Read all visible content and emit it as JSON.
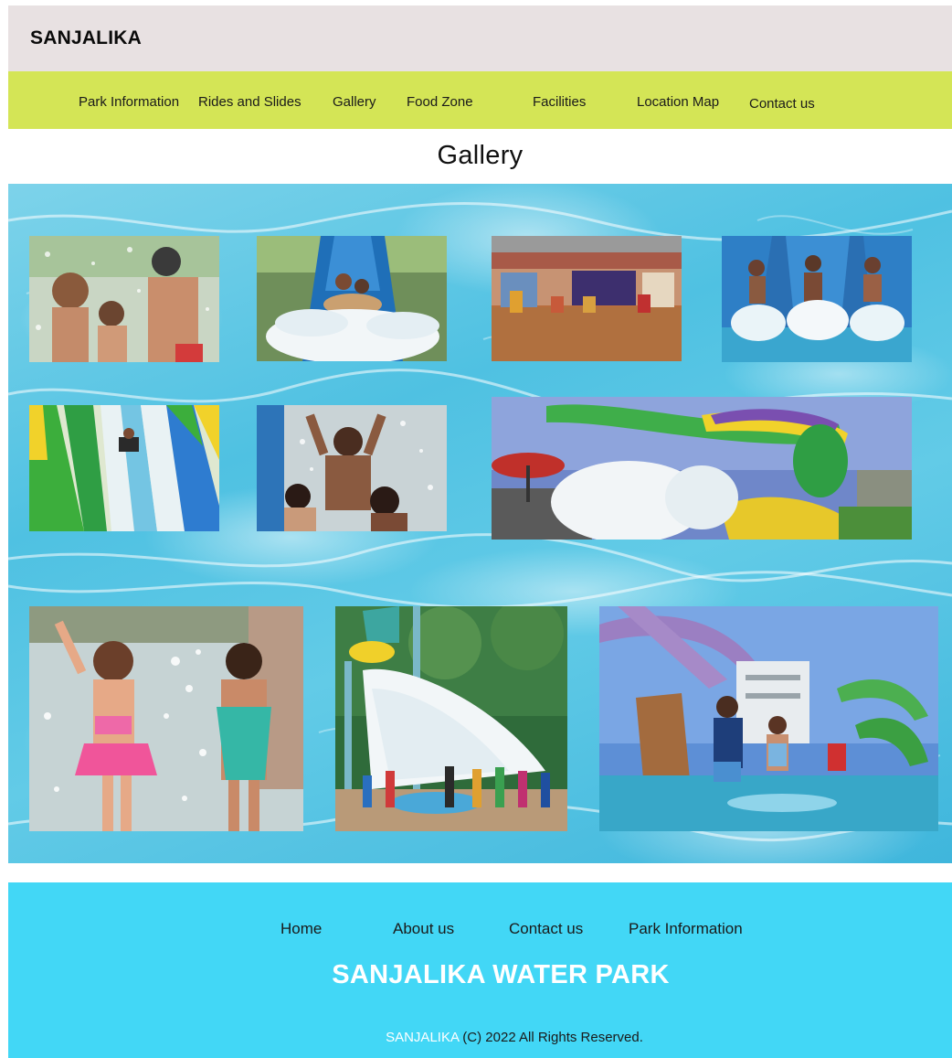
{
  "header": {
    "brand": "SANJALIKA"
  },
  "nav": {
    "items": [
      {
        "label": "Park Information"
      },
      {
        "label": "Rides and Slides"
      },
      {
        "label": "Gallery"
      },
      {
        "label": "Food Zone"
      },
      {
        "label": "Facilities"
      },
      {
        "label": "Location Map"
      },
      {
        "label": "Contact us"
      }
    ]
  },
  "main": {
    "title": "Gallery",
    "photos": [
      {
        "subject": "family-splash-photo"
      },
      {
        "subject": "raft-slide-photo"
      },
      {
        "subject": "magic-show-stage-photo"
      },
      {
        "subject": "slide-splash-photo"
      },
      {
        "subject": "mat-racer-slide-photo"
      },
      {
        "subject": "boy-water-play-photo"
      },
      {
        "subject": "water-slide-tower-photo"
      },
      {
        "subject": "girls-splashing-photo"
      },
      {
        "subject": "tipping-bucket-photo"
      },
      {
        "subject": "resort-pool-photo"
      }
    ]
  },
  "footer": {
    "links": [
      {
        "label": "Home"
      },
      {
        "label": "About us"
      },
      {
        "label": "Contact us"
      },
      {
        "label": "Park Information"
      }
    ],
    "title": "SANJALIKA WATER PARK",
    "copyright_brand": "SANJALIKA",
    "copyright_text": " (C) 2022 All Rights Reserved."
  },
  "colors": {
    "topbar": "#e8e1e2",
    "navbar": "#d4e556",
    "footer": "#42d7f6",
    "water": "#4fc1e2"
  }
}
